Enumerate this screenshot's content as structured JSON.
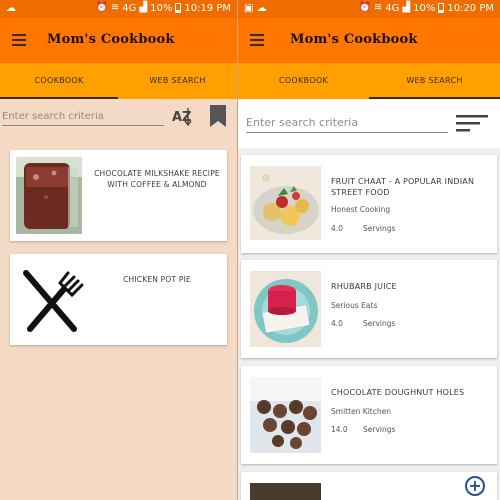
{
  "left": {
    "status": {
      "notification_icon": "cloud-icon",
      "signal": "4G",
      "battery": "10%",
      "time": "10:19 PM"
    },
    "toolbar": {
      "menu_icon": "hamburger-menu-icon",
      "title": "Mom's Cookbook"
    },
    "tabs": [
      {
        "label": "COOKBOOK",
        "active": true
      },
      {
        "label": "WEB SEARCH",
        "active": false
      }
    ],
    "search": {
      "placeholder": "Enter search criteria",
      "sort_icon": "sort-az-icon",
      "bookmark_icon": "bookmark-icon"
    },
    "recipes": [
      {
        "title": "CHOCOLATE MILKSHAKE RECIPE WITH COFFEE & ALMOND",
        "image": "milkshake-jar-photo"
      },
      {
        "title": "CHICKEN POT PIE",
        "image": "fork-knife-icon"
      }
    ]
  },
  "right": {
    "status": {
      "notification_icon": "cloud-icon",
      "signal": "4G",
      "battery": "10%",
      "time": "10:20 PM"
    },
    "toolbar": {
      "menu_icon": "hamburger-menu-icon",
      "title": "Mom's Cookbook"
    },
    "tabs": [
      {
        "label": "COOKBOOK",
        "active": false
      },
      {
        "label": "WEB SEARCH",
        "active": true
      }
    ],
    "search": {
      "placeholder": "Enter search criteria",
      "filter_icon": "sort-lines-icon"
    },
    "results": [
      {
        "title": "FRUIT CHAAT - A POPULAR INDIAN STREET FOOD",
        "source": "Honest Cooking",
        "rating": "4.0",
        "servings_label": "Servings",
        "image": "fruit-chaat-photo"
      },
      {
        "title": "RHUBARB JUICE",
        "source": "Serious Eats",
        "rating": "4.0",
        "servings_label": "Servings",
        "image": "rhubarb-juice-photo"
      },
      {
        "title": "CHOCOLATE DOUGHNUT HOLES",
        "source": "Smitten Kitchen",
        "rating": "14.0",
        "servings_label": "Servings",
        "image": "doughnut-holes-photo"
      },
      {
        "title": "",
        "image": "partial-result-photo"
      }
    ],
    "fab_icon": "add-circle-icon"
  },
  "colors": {
    "status_bar": "#ef6c00",
    "toolbar": "#ff7700",
    "tabs": "#ffa000",
    "left_background": "#f4d9c5",
    "right_background": "#efefef",
    "fab": "#2a4f9a"
  }
}
